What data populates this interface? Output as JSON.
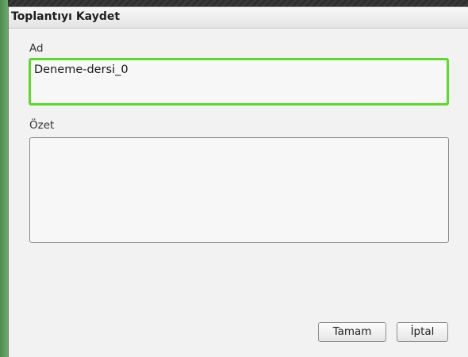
{
  "dialog": {
    "title": "Toplantıyı Kaydet"
  },
  "fields": {
    "name_label": "Ad",
    "name_value": "Deneme-dersi_0",
    "summary_label": "Özet",
    "summary_value": ""
  },
  "buttons": {
    "ok_label": "Tamam",
    "cancel_label": "İptal"
  },
  "colors": {
    "focus_border": "#5adb28",
    "background_app": "#5f9e5f"
  }
}
